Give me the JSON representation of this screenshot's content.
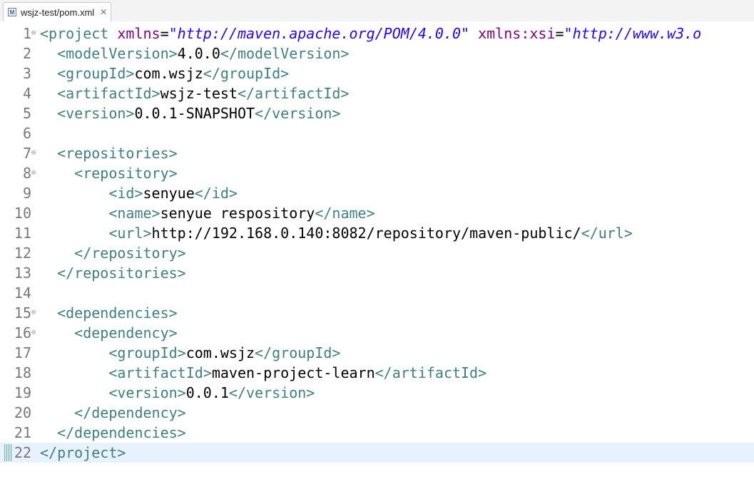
{
  "tab": {
    "icon": "maven-pom-file-icon",
    "label": "wsjz-test/pom.xml",
    "close_glyph": "✕"
  },
  "editor": {
    "fold_glyph": "⊖",
    "lines": [
      {
        "num": "1",
        "fold": true,
        "tokens": [
          {
            "t": "tg",
            "v": "<project "
          },
          {
            "t": "an",
            "v": "xmlns"
          },
          {
            "t": "tx",
            "v": "="
          },
          {
            "t": "av",
            "v": "\"http://maven.apache.org/POM/4.0.0\""
          },
          {
            "t": "tx",
            "v": " "
          },
          {
            "t": "an",
            "v": "xmlns:xsi"
          },
          {
            "t": "tx",
            "v": "="
          },
          {
            "t": "av",
            "v": "\"http://www.w3.o"
          }
        ]
      },
      {
        "num": "2",
        "tokens": [
          {
            "t": "tx",
            "v": "  "
          },
          {
            "t": "tg",
            "v": "<modelVersion>"
          },
          {
            "t": "tx",
            "v": "4.0.0"
          },
          {
            "t": "tg",
            "v": "</modelVersion>"
          }
        ]
      },
      {
        "num": "3",
        "tokens": [
          {
            "t": "tx",
            "v": "  "
          },
          {
            "t": "tg",
            "v": "<groupId>"
          },
          {
            "t": "tx",
            "v": "com.wsjz"
          },
          {
            "t": "tg",
            "v": "</groupId>"
          }
        ]
      },
      {
        "num": "4",
        "tokens": [
          {
            "t": "tx",
            "v": "  "
          },
          {
            "t": "tg",
            "v": "<artifactId>"
          },
          {
            "t": "tx",
            "v": "wsjz-test"
          },
          {
            "t": "tg",
            "v": "</artifactId>"
          }
        ]
      },
      {
        "num": "5",
        "tokens": [
          {
            "t": "tx",
            "v": "  "
          },
          {
            "t": "tg",
            "v": "<version>"
          },
          {
            "t": "tx",
            "v": "0.0.1-SNAPSHOT"
          },
          {
            "t": "tg",
            "v": "</version>"
          }
        ]
      },
      {
        "num": "6",
        "tokens": []
      },
      {
        "num": "7",
        "fold": true,
        "tokens": [
          {
            "t": "tx",
            "v": "  "
          },
          {
            "t": "tg",
            "v": "<repositories>"
          }
        ]
      },
      {
        "num": "8",
        "fold": true,
        "tokens": [
          {
            "t": "tx",
            "v": "    "
          },
          {
            "t": "tg",
            "v": "<repository>"
          }
        ]
      },
      {
        "num": "9",
        "tokens": [
          {
            "t": "tx",
            "v": "        "
          },
          {
            "t": "tg",
            "v": "<id>"
          },
          {
            "t": "tx",
            "v": "senyue"
          },
          {
            "t": "tg",
            "v": "</id>"
          }
        ]
      },
      {
        "num": "10",
        "tokens": [
          {
            "t": "tx",
            "v": "        "
          },
          {
            "t": "tg",
            "v": "<name>"
          },
          {
            "t": "tx",
            "v": "senyue respository"
          },
          {
            "t": "tg",
            "v": "</name>"
          }
        ]
      },
      {
        "num": "11",
        "tokens": [
          {
            "t": "tx",
            "v": "        "
          },
          {
            "t": "tg",
            "v": "<url>"
          },
          {
            "t": "tx",
            "v": "http://192.168.0.140:8082/repository/maven-public/"
          },
          {
            "t": "tg",
            "v": "</url>"
          }
        ]
      },
      {
        "num": "12",
        "tokens": [
          {
            "t": "tx",
            "v": "    "
          },
          {
            "t": "tg",
            "v": "</repository>"
          }
        ]
      },
      {
        "num": "13",
        "tokens": [
          {
            "t": "tx",
            "v": "  "
          },
          {
            "t": "tg",
            "v": "</repositories>"
          }
        ]
      },
      {
        "num": "14",
        "tokens": []
      },
      {
        "num": "15",
        "fold": true,
        "tokens": [
          {
            "t": "tx",
            "v": "  "
          },
          {
            "t": "tg",
            "v": "<dependencies>"
          }
        ]
      },
      {
        "num": "16",
        "fold": true,
        "tokens": [
          {
            "t": "tx",
            "v": "    "
          },
          {
            "t": "tg",
            "v": "<dependency>"
          }
        ]
      },
      {
        "num": "17",
        "tokens": [
          {
            "t": "tx",
            "v": "        "
          },
          {
            "t": "tg",
            "v": "<groupId>"
          },
          {
            "t": "tx",
            "v": "com.wsjz"
          },
          {
            "t": "tg",
            "v": "</groupId>"
          }
        ]
      },
      {
        "num": "18",
        "tokens": [
          {
            "t": "tx",
            "v": "        "
          },
          {
            "t": "tg",
            "v": "<artifactId>"
          },
          {
            "t": "tx",
            "v": "maven-project-learn"
          },
          {
            "t": "tg",
            "v": "</artifactId>"
          }
        ]
      },
      {
        "num": "19",
        "tokens": [
          {
            "t": "tx",
            "v": "        "
          },
          {
            "t": "tg",
            "v": "<version>"
          },
          {
            "t": "tx",
            "v": "0.0.1"
          },
          {
            "t": "tg",
            "v": "</version>"
          }
        ]
      },
      {
        "num": "20",
        "tokens": [
          {
            "t": "tx",
            "v": "    "
          },
          {
            "t": "tg",
            "v": "</dependency>"
          }
        ]
      },
      {
        "num": "21",
        "tokens": [
          {
            "t": "tx",
            "v": "  "
          },
          {
            "t": "tg",
            "v": "</dependencies>"
          }
        ]
      },
      {
        "num": "22",
        "current": true,
        "marker": true,
        "tokens": [
          {
            "t": "tg",
            "v": "</project>"
          }
        ]
      }
    ]
  },
  "colors": {
    "tag": "#3f7f7f",
    "attribute_name": "#7f007f",
    "attribute_value": "#2a00ff",
    "text": "#000000",
    "current_line": "#e8f2fe",
    "line_number": "#787878"
  }
}
